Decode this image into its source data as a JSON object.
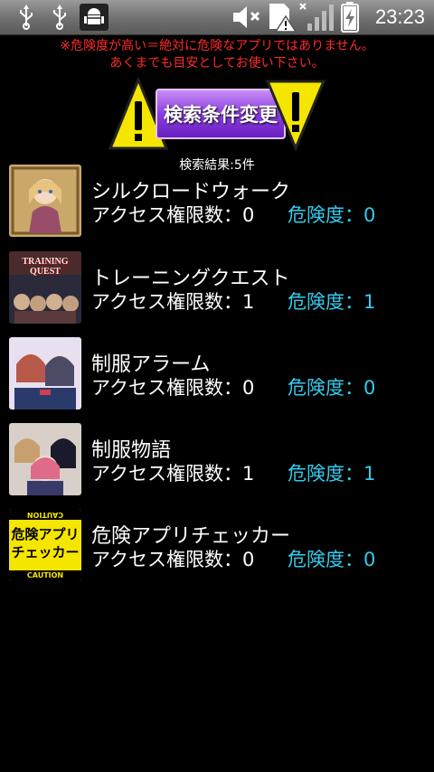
{
  "status_bar": {
    "time": "23:23",
    "icons": [
      "usb-icon",
      "usb-icon",
      "android-debug-icon",
      "volume-muted-icon",
      "sd-card-warning-icon",
      "no-signal-icon",
      "battery-charging-icon"
    ]
  },
  "warning": {
    "line1": "※危険度が高い＝絶対に危険なアプリではありません。",
    "line2": "あくまでも目安としてお使い下さい。",
    "color": "#ff2a2a"
  },
  "search_button": {
    "label": "検索条件変更",
    "accent": "#8a3fe0",
    "warning_color": "#f5e600"
  },
  "result_count": "検索結果:5件",
  "risk_color": "#33ccee",
  "apps": [
    {
      "name": "シルクロードウォーク",
      "permissions_text": "アクセス権限数：0",
      "risk_text": "危険度：0",
      "icon": "silk-road-walk-icon"
    },
    {
      "name": "トレーニングクエスト",
      "permissions_text": "アクセス権限数：1",
      "risk_text": "危険度：1",
      "icon": "training-quest-icon",
      "icon_text": "TRAINING QUEST"
    },
    {
      "name": "制服アラーム",
      "permissions_text": "アクセス権限数：0",
      "risk_text": "危険度：0",
      "icon": "uniform-alarm-icon"
    },
    {
      "name": "制服物語",
      "permissions_text": "アクセス権限数：1",
      "risk_text": "危険度：1",
      "icon": "uniform-story-icon"
    },
    {
      "name": "危険アプリチェッカー",
      "permissions_text": "アクセス権限数：0",
      "risk_text": "危険度：0",
      "icon": "danger-app-checker-icon",
      "icon_text": "危険アプリ チェッカー",
      "icon_caution": "CAUTION"
    }
  ]
}
